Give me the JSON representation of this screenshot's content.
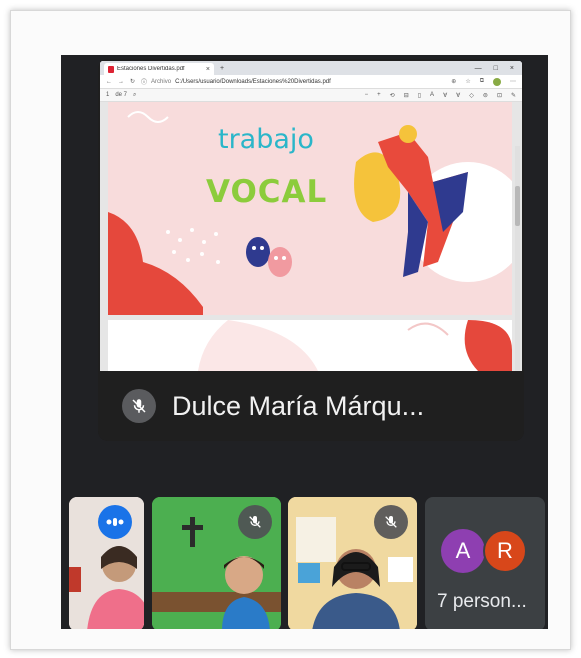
{
  "browser": {
    "tab_title": "Estaciones Divertidas.pdf",
    "tab_close": "×",
    "new_tab": "+",
    "window_controls": [
      "—",
      "□",
      "×"
    ],
    "address_label": "Archivo",
    "address_url": "C:/Users/usuario/Downloads/Estaciones%20Divertidas.pdf",
    "page_number": "de 7"
  },
  "slide": {
    "title_line1": "trabajo",
    "title_line2": "VOCAL"
  },
  "presenter": {
    "name": "Dulce María Márqu..."
  },
  "participants": {
    "avatar_a_letter": "A",
    "avatar_r_letter": "R",
    "others_label": "7 person..."
  },
  "colors": {
    "meet_bg": "#202124",
    "speaking_badge": "#1a73e8",
    "avatar_a": "#8e3fb1",
    "avatar_r": "#d8471a",
    "slide_bg": "#f8dcdc",
    "title_teal": "#2bb6c9",
    "title_green": "#8ccc3c"
  }
}
